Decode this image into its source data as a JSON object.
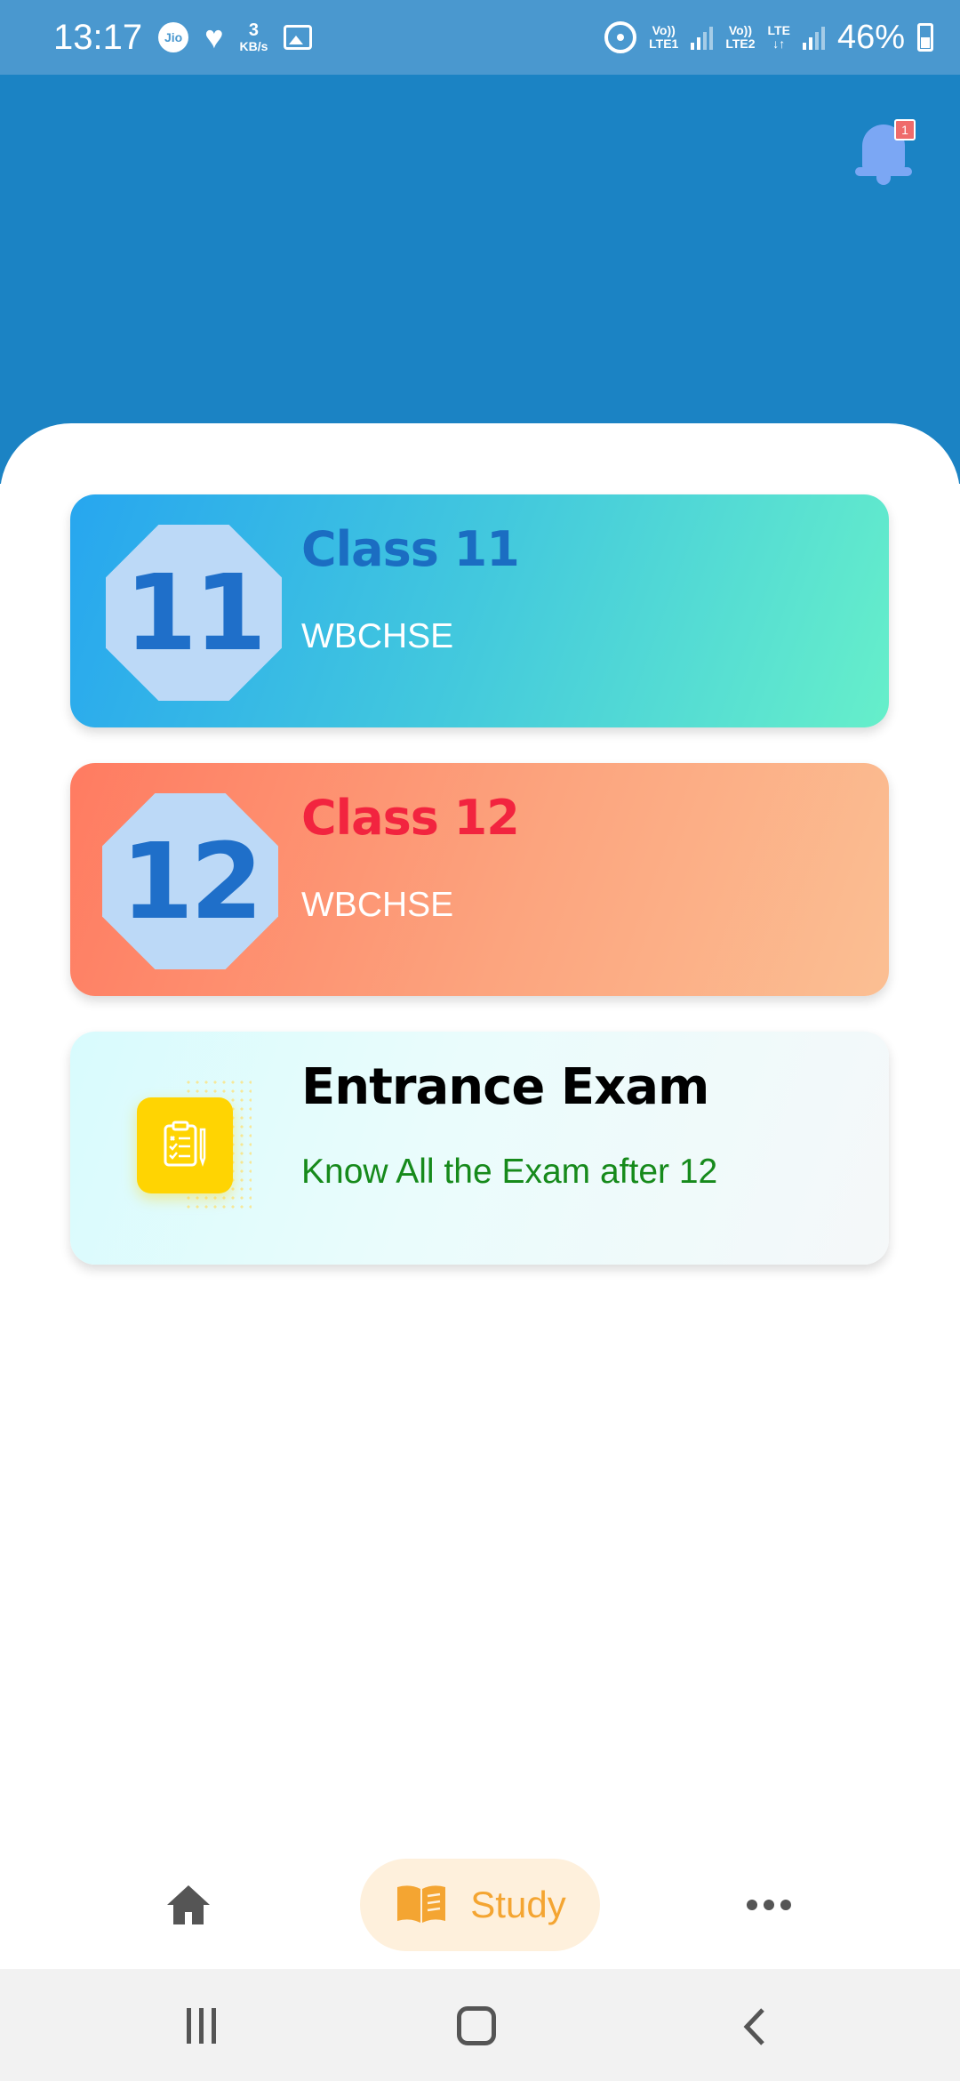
{
  "status_bar": {
    "time": "13:17",
    "carrier_icon": "Jio",
    "speed_value": "3",
    "speed_unit": "KB/s",
    "sim1_label_top": "Vo))",
    "sim1_label_bottom": "LTE1",
    "sim2_label_top": "Vo))",
    "sim2_label_bottom": "LTE2",
    "data_label_top": "LTE",
    "data_label_bottom": "↓↑",
    "battery": "46%"
  },
  "header": {
    "notification_count": "1"
  },
  "cards": [
    {
      "badge_number": "11",
      "title": "Class 11",
      "subtitle": "WBCHSE"
    },
    {
      "badge_number": "12",
      "title": "Class 12",
      "subtitle": "WBCHSE"
    },
    {
      "title": "Entrance Exam",
      "subtitle": "Know All the Exam after 12"
    }
  ],
  "bottom_nav": {
    "active_label": "Study"
  },
  "colors": {
    "header_bg": "#1b83c4",
    "status_bar_bg": "#4a98cf",
    "class11_title": "#1b6dc2",
    "class12_title": "#f2243f",
    "exam_subtitle": "#168a1b",
    "nav_active": "#f4a532"
  },
  "icons": [
    "jio-icon",
    "heart-icon",
    "gallery-icon",
    "hotspot-icon",
    "signal-icon",
    "battery-icon",
    "bell-icon",
    "clipboard-icon",
    "home-icon",
    "book-icon",
    "more-icon",
    "recents-icon",
    "home-button-icon",
    "back-icon"
  ]
}
